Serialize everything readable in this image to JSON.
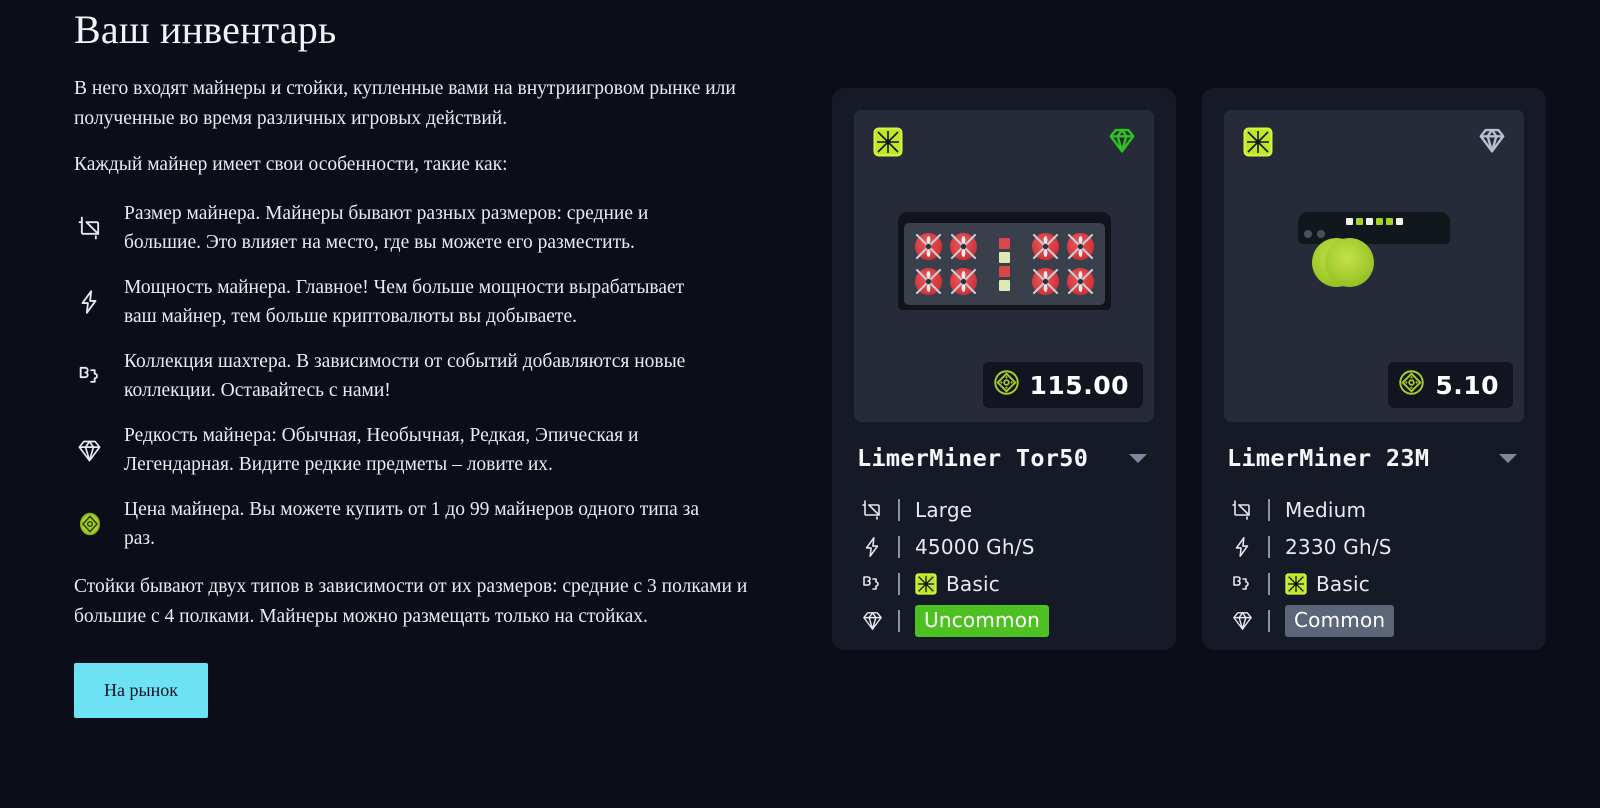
{
  "header": {
    "title": "Ваш инвентарь"
  },
  "intro": {
    "paragraph1": "В него входят майнеры и стойки, купленные вами на внутриигровом рынке или полученные во время различных игровых действий.",
    "paragraph2": "Каждый майнер имеет свои особенности, такие как:"
  },
  "features": [
    {
      "icon": "miner-size-icon",
      "text": "Размер майнера. Майнеры бывают разных размеров: средние и большие. Это влияет на место, где вы можете его разместить."
    },
    {
      "icon": "lightning-bolt-icon",
      "text": "Мощность майнера. Главное! Чем больше мощности вырабатывает ваш майнер, тем больше криптовалюты вы добываете."
    },
    {
      "icon": "puzzle-piece-icon",
      "text": "Коллекция шахтера. В зависимости от событий добавляются новые коллекции. Оставайтесь с нами!"
    },
    {
      "icon": "diamond-icon",
      "text": "Редкость майнера: Обычная, Необычная, Редкая, Эпическая и Легендарная. Видите редкие предметы – ловите их."
    },
    {
      "icon": "coin-icon",
      "text": "Цена майнера. Вы можете купить от 1 до 99 майнеров одного типа за раз."
    }
  ],
  "closing": {
    "paragraph": "Стойки бывают двух типов в зависимости от их размеров: средние с 3 полками и большие с 4 полками. Майнеры можно размещать только на стойках."
  },
  "actions": {
    "market_button": "На рынок"
  },
  "colors": {
    "background": "#0b0d18",
    "card_background": "#161a27",
    "card_visual_background": "#272b39",
    "accent_cyan": "#6ee2f5",
    "accent_green": "#a6d327",
    "rarity_uncommon": "#4ec122",
    "rarity_common": "#5d6579"
  },
  "cards": [
    {
      "title": "LimerMiner Tor50",
      "collection_badge_icon": "fan-grid-icon",
      "rarity_icon": "diamond-icon",
      "rarity_icon_color": "#2fc51f",
      "price": "115.00",
      "price_icon": "coin-icon",
      "dropdown_icon": "chevron-down-icon",
      "artwork": {
        "type": "large-miner",
        "fan_color": "red",
        "fan_count": 8,
        "led_sequence": [
          "r",
          "g",
          "r",
          "g"
        ]
      },
      "specs": [
        {
          "icon": "miner-size-icon",
          "label": "size",
          "value": "Large"
        },
        {
          "icon": "lightning-bolt-icon",
          "label": "power",
          "value": "45000 Gh/S"
        },
        {
          "icon": "puzzle-piece-icon",
          "label": "collection",
          "value": "Basic",
          "chip_icon": "fan-grid-icon"
        },
        {
          "icon": "diamond-icon",
          "label": "rarity",
          "value": "Uncommon",
          "tag": "uncommon"
        }
      ]
    },
    {
      "title": "LimerMiner 23M",
      "collection_badge_icon": "fan-grid-icon",
      "rarity_icon": "diamond-icon",
      "rarity_icon_color": "#b9bfd0",
      "price": "5.10",
      "price_icon": "coin-icon",
      "dropdown_icon": "chevron-down-icon",
      "artwork": {
        "type": "medium-miner",
        "fan_color": "green",
        "fan_count": 2,
        "led_sequence": [
          "w",
          "g",
          "w",
          "g",
          "g",
          "w"
        ]
      },
      "specs": [
        {
          "icon": "miner-size-icon",
          "label": "size",
          "value": "Medium"
        },
        {
          "icon": "lightning-bolt-icon",
          "label": "power",
          "value": "2330 Gh/S"
        },
        {
          "icon": "puzzle-piece-icon",
          "label": "collection",
          "value": "Basic",
          "chip_icon": "fan-grid-icon"
        },
        {
          "icon": "diamond-icon",
          "label": "rarity",
          "value": "Common",
          "tag": "common"
        }
      ]
    }
  ]
}
